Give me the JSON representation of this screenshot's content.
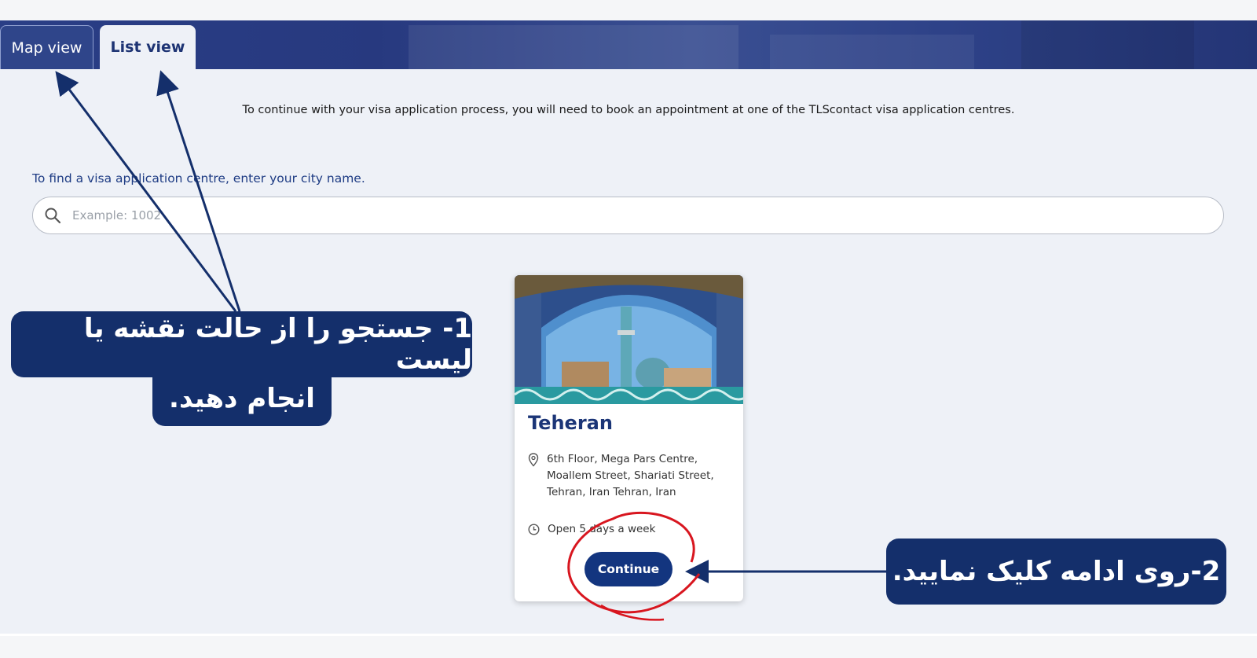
{
  "tabs": {
    "map_view": "Map view",
    "list_view": "List view"
  },
  "intro_text": "To continue with your visa application process, you will need to book an appointment at one of the TLScontact visa application centres.",
  "search": {
    "label": "To find a visa application centre, enter your city name.",
    "placeholder": "Example: 1002"
  },
  "centre_card": {
    "city": "Teheran",
    "address": "6th Floor, Mega Pars Centre, Moallem Street, Shariati Street, Tehran, Iran Tehran, Iran",
    "hours": "Open 5 days a week",
    "continue_label": "Continue"
  },
  "annotations": {
    "step1_line1": "1- جستجو را از حالت نقشه یا لیست",
    "step1_line2": "انجام دهید.",
    "step2": "2-روی ادامه کلیک نمایید."
  },
  "colors": {
    "navy": "#142f6b",
    "brand_blue": "#13357f",
    "highlight_red": "#d8161f"
  }
}
